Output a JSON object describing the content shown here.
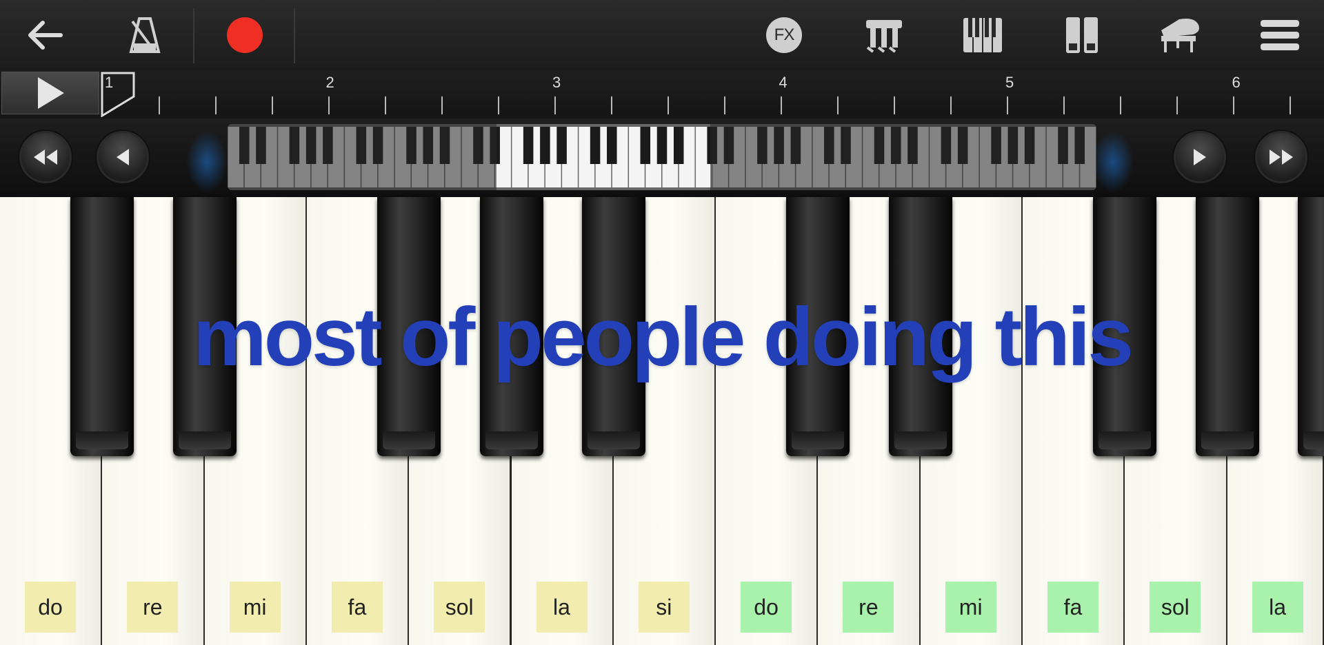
{
  "toolbar": {
    "icons": [
      "back-arrow-icon",
      "metronome-icon",
      "record-icon",
      "fx-icon",
      "chord-icon",
      "keyboard-layout-icon",
      "dual-keyboard-icon",
      "grand-piano-icon",
      "menu-icon"
    ],
    "fx_label": "FX",
    "record_color": "#ef2f24"
  },
  "timeline": {
    "bars": [
      "1",
      "2",
      "3",
      "4",
      "5",
      "6"
    ]
  },
  "keyboard": {
    "notes": [
      {
        "label": "do",
        "color": "#f2edae"
      },
      {
        "label": "re",
        "color": "#f2edae"
      },
      {
        "label": "mi",
        "color": "#f2edae"
      },
      {
        "label": "fa",
        "color": "#f2edae"
      },
      {
        "label": "sol",
        "color": "#f2edae"
      },
      {
        "label": "la",
        "color": "#f2edae"
      },
      {
        "label": "si",
        "color": "#f2edae"
      },
      {
        "label": "do",
        "color": "#a9f2ac"
      },
      {
        "label": "re",
        "color": "#a9f2ac"
      },
      {
        "label": "mi",
        "color": "#a9f2ac"
      },
      {
        "label": "fa",
        "color": "#a9f2ac"
      },
      {
        "label": "sol",
        "color": "#a9f2ac"
      },
      {
        "label": "la",
        "color": "#a9f2ac"
      }
    ]
  },
  "overlay_caption": "most of people doing this"
}
